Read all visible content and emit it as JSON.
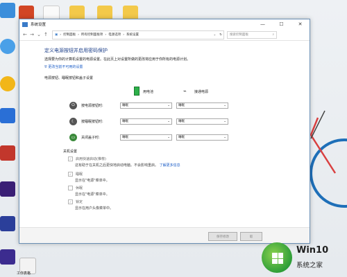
{
  "window": {
    "title": "系统设置",
    "min_label": "—",
    "max_label": "☐",
    "close_label": "✕"
  },
  "address": {
    "path": [
      "控制面板",
      "所有控制面板项",
      "电源选项",
      "系统设置"
    ],
    "search_placeholder": "搜索控制面板"
  },
  "content": {
    "heading": "定义电源按钮并启用密码保护",
    "desc": "选择要为你的计算机设置的电源设置。在此页上对设置所做的更改将应用于你所有的电源计划。",
    "change_link": "更改当前不可用的设置",
    "power_section": "电源按钮、睡眠按钮和盖子设置",
    "col_battery": "用电池",
    "col_plugged": "接通电源",
    "rows": [
      {
        "label": "按电源按钮时:",
        "battery": "睡眠",
        "plugged": "睡眠"
      },
      {
        "label": "按睡眠按钮时:",
        "battery": "睡眠",
        "plugged": "睡眠"
      },
      {
        "label": "关闭盖子时:",
        "battery": "睡眠",
        "plugged": "睡眠"
      }
    ],
    "shutdown_section": "关机设置",
    "options": [
      {
        "label": "启用快速启动(推荐)",
        "desc": "这有助于在关机之后更快地启动电脑。不会影响重启。",
        "link": "了解更多信息",
        "checked": true
      },
      {
        "label": "睡眠",
        "desc": "显示在\"电源\"菜单中。",
        "checked": true
      },
      {
        "label": "休眠",
        "desc": "显示在\"电源\"菜单中。",
        "checked": false
      },
      {
        "label": "锁定",
        "desc": "显示在用户头像菜单中。",
        "checked": true
      }
    ],
    "save_button": "保存修改",
    "cancel_button": "取"
  },
  "desktop": {
    "icon_label": "工作表格"
  },
  "watermark": {
    "line1": "Win10",
    "line2": "系统之家"
  },
  "colors": {
    "link": "#1a5cc7",
    "heading": "#1c3f8a",
    "window_border": "#6a8fb5"
  }
}
